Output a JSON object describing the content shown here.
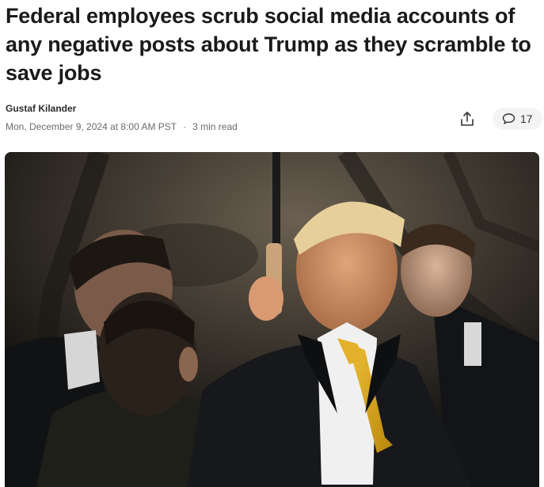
{
  "article": {
    "headline": "Federal employees scrub social media accounts of any negative posts about Trump as they scramble to save jobs",
    "author": "Gustaf Kilander",
    "date": "Mon, December 9, 2024 at 8:00 AM PST",
    "separator": "·",
    "read_time": "3 min read"
  },
  "actions": {
    "share_icon": "share-upload-icon",
    "comment_icon": "speech-bubble-icon",
    "comment_count": "17"
  },
  "hero_image": {
    "subject": "photograph of men in dark coats at night, one holding an umbrella handle"
  },
  "colors": {
    "text": "#1a1a1a",
    "meta": "#6b6b6b",
    "pill_bg": "#f4f4f4",
    "tie_gold": "#d9a520"
  }
}
